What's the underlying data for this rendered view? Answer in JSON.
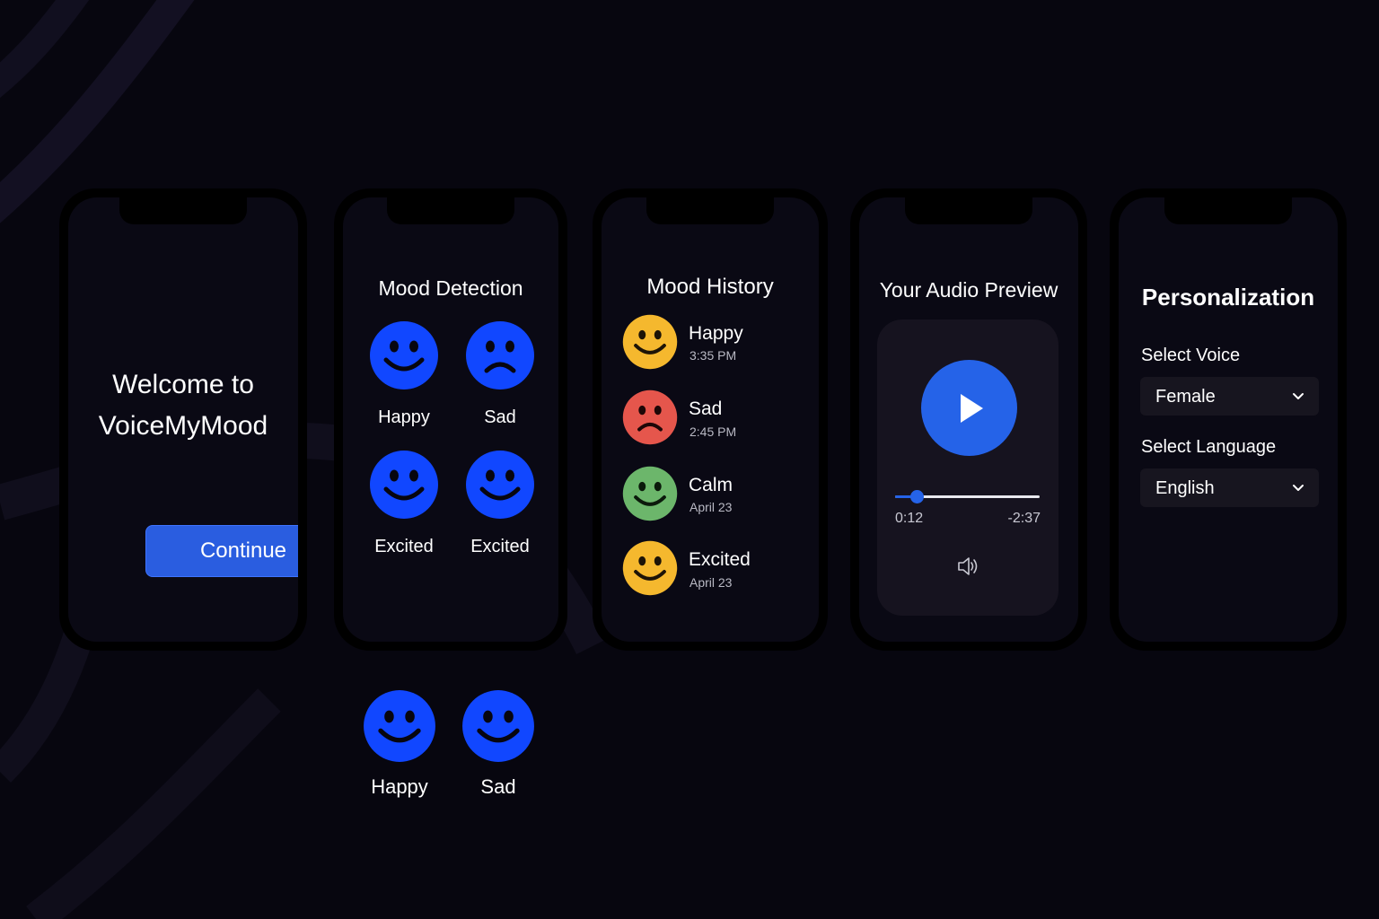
{
  "colors": {
    "background": "#07060f",
    "accent_blue": "#2563e8",
    "face_blue": "#1147ff",
    "happy_yellow": "#f5b82e",
    "sad_red": "#e5564c",
    "calm_green": "#6cb66b"
  },
  "welcome": {
    "title_line1": "Welcome to",
    "title_line2": "VoiceMyMood",
    "continue_label": "Continue"
  },
  "detection": {
    "title": "Mood Detection",
    "moods": [
      {
        "label": "Happy",
        "icon": "smiley-face-icon"
      },
      {
        "label": "Sad",
        "icon": "sad-face-icon"
      },
      {
        "label": "Excited",
        "icon": "smiley-face-icon"
      },
      {
        "label": "Excited",
        "icon": "smiley-face-icon"
      }
    ],
    "extra_moods": [
      {
        "label": "Happy",
        "icon": "smiley-face-icon"
      },
      {
        "label": "Sad",
        "icon": "smiley-face-icon"
      }
    ]
  },
  "history": {
    "title": "Mood History",
    "entries": [
      {
        "mood": "Happy",
        "time": "3:35 PM",
        "icon": "smiley-face-icon"
      },
      {
        "mood": "Sad",
        "time": "2:45 PM",
        "icon": "sad-face-icon"
      },
      {
        "mood": "Calm",
        "time": "April 23",
        "icon": "smiley-face-icon"
      },
      {
        "mood": "Excited",
        "time": "April 23",
        "icon": "smiley-face-icon"
      }
    ]
  },
  "audio": {
    "title": "Your Audio Preview",
    "elapsed": "0:12",
    "remaining": "-2:37",
    "progress": 0.15,
    "play_icon": "play-icon",
    "volume_icon": "speaker-icon"
  },
  "personalization": {
    "title": "Personalization",
    "voice_label": "Select Voice",
    "voice_value": "Female",
    "language_label": "Select Language",
    "language_value": "English"
  }
}
